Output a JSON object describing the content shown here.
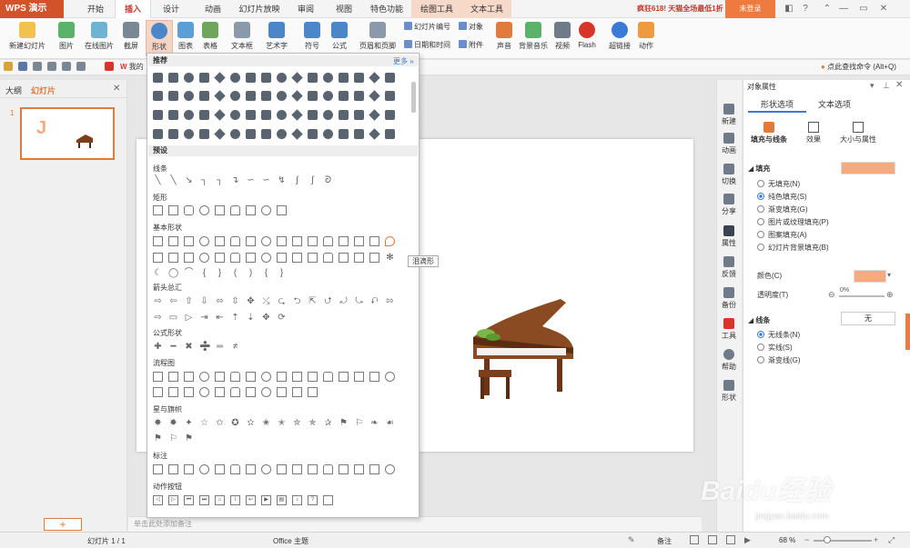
{
  "app": {
    "name": "WPS 演示",
    "promo": "疯狂618! 天猫全场最低1折起",
    "login": "未登录"
  },
  "tabs": [
    "开始",
    "插入",
    "设计",
    "动画",
    "幻灯片放映",
    "审阅",
    "视图",
    "特色功能",
    "绘图工具",
    "文本工具"
  ],
  "ribbon": {
    "new_slide": "新建幻灯片",
    "picture": "图片",
    "online_picture": "在线图片",
    "screenshot": "截屏",
    "shapes": "形状",
    "chart": "图表",
    "table": "表格",
    "textbox": "文本框",
    "wordart": "艺术字",
    "symbol": "符号",
    "formula": "公式",
    "header_footer": "页眉和页脚",
    "slide_number": "幻灯片编号",
    "object": "对象",
    "date_time": "日期和时间",
    "attachment": "附件",
    "audio": "声音",
    "bg_music": "背景音乐",
    "video": "视频",
    "flash": "Flash",
    "hyperlink": "超链接",
    "action": "动作"
  },
  "qat": {
    "search": "点此查找命令 (Alt+Q)",
    "mine": "我的"
  },
  "left_panel": {
    "tab_outline": "大纲",
    "tab_slides": "幻灯片",
    "slide_num": "1",
    "add": "+"
  },
  "slide": {
    "char": "J"
  },
  "notes_placeholder": "单击此处添加备注",
  "dropdown": {
    "recommended": "推荐",
    "more": "更多 »",
    "presets": "预设",
    "categories": [
      "线条",
      "矩形",
      "基本形状",
      "箭头总汇",
      "公式形状",
      "流程图",
      "星与旗帜",
      "标注",
      "动作按钮"
    ],
    "tooltip": "泪滴形"
  },
  "side_icons": [
    "新建",
    "动画",
    "切换",
    "分享",
    "属性",
    "反馈",
    "备份",
    "工具",
    "帮助",
    "形状"
  ],
  "obj_panel": {
    "title": "对象属性",
    "tab_shape": "形状选项",
    "tab_text": "文本选项",
    "sub_fill_line": "填充与线条",
    "sub_effect": "效果",
    "sub_size": "大小与属性",
    "fill_header": "填充",
    "fill_options": [
      "无填充(N)",
      "纯色填充(S)",
      "渐变填充(G)",
      "图片或纹理填充(P)",
      "图案填充(A)",
      "幻灯片背景填充(B)"
    ],
    "fill_selected": 1,
    "color_label": "颜色(C)",
    "transparency_label": "透明度(T)",
    "transparency_value": "0%",
    "line_header": "线条",
    "line_value": "无",
    "line_options": [
      "无线条(N)",
      "实线(S)",
      "渐变线(G)"
    ],
    "line_selected": 0,
    "fill_color": "#f4ab82"
  },
  "status": {
    "slide": "幻灯片 1 / 1",
    "theme": "Office 主题",
    "notes": "备注",
    "zoom": "68 %"
  },
  "watermark": {
    "main": "Baidu经验",
    "sub": "jingyan.baidu.com"
  },
  "colors": {
    "accent": "#d2522a",
    "selected_fill": "#f4ab82"
  }
}
